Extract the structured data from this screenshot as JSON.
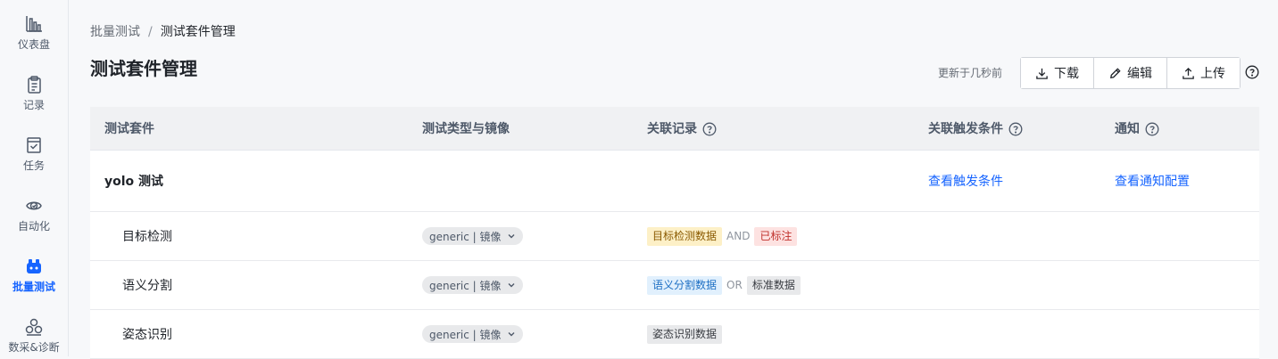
{
  "sidebar": {
    "items": [
      {
        "label": "仪表盘",
        "icon": "dashboard-chart-icon",
        "active": false
      },
      {
        "label": "记录",
        "icon": "clipboard-icon",
        "active": false
      },
      {
        "label": "任务",
        "icon": "task-check-icon",
        "active": false
      },
      {
        "label": "自动化",
        "icon": "automation-icon",
        "active": false
      },
      {
        "label": "批量测试",
        "icon": "batch-test-icon",
        "active": true
      },
      {
        "label": "数采&诊断",
        "icon": "diagnosis-icon",
        "active": false
      }
    ]
  },
  "breadcrumb": {
    "parent": "批量测试",
    "separator": "/",
    "current": "测试套件管理"
  },
  "page": {
    "title": "测试套件管理"
  },
  "toolbar": {
    "updated_text": "更新于几秒前",
    "download_label": "下载",
    "edit_label": "编辑",
    "upload_label": "上传",
    "help_icon": "help-circle-icon"
  },
  "table": {
    "headers": {
      "suite": "测试套件",
      "type_image": "测试类型与镜像",
      "records": "关联记录",
      "triggers": "关联触发条件",
      "notify": "通知"
    },
    "group": {
      "name": "yolo 测试",
      "trigger_link": "查看触发条件",
      "notify_link": "查看通知配置"
    },
    "rows": [
      {
        "name": "目标检测",
        "type": "generic | 镜像",
        "record_a": "目标检测数据",
        "operator": "AND",
        "record_b": "已标注"
      },
      {
        "name": "语义分割",
        "type": "generic | 镜像",
        "record_a": "语义分割数据",
        "operator": "OR",
        "record_b": "标准数据"
      },
      {
        "name": "姿态识别",
        "type": "generic | 镜像",
        "record_a": "姿态识别数据"
      }
    ]
  },
  "colors": {
    "accent": "#1664ff",
    "tag_yellow": "#fdf0c7",
    "tag_red": "#fde2e1",
    "tag_blue": "#e1f0fd",
    "tag_gray": "#e8e9eb"
  }
}
